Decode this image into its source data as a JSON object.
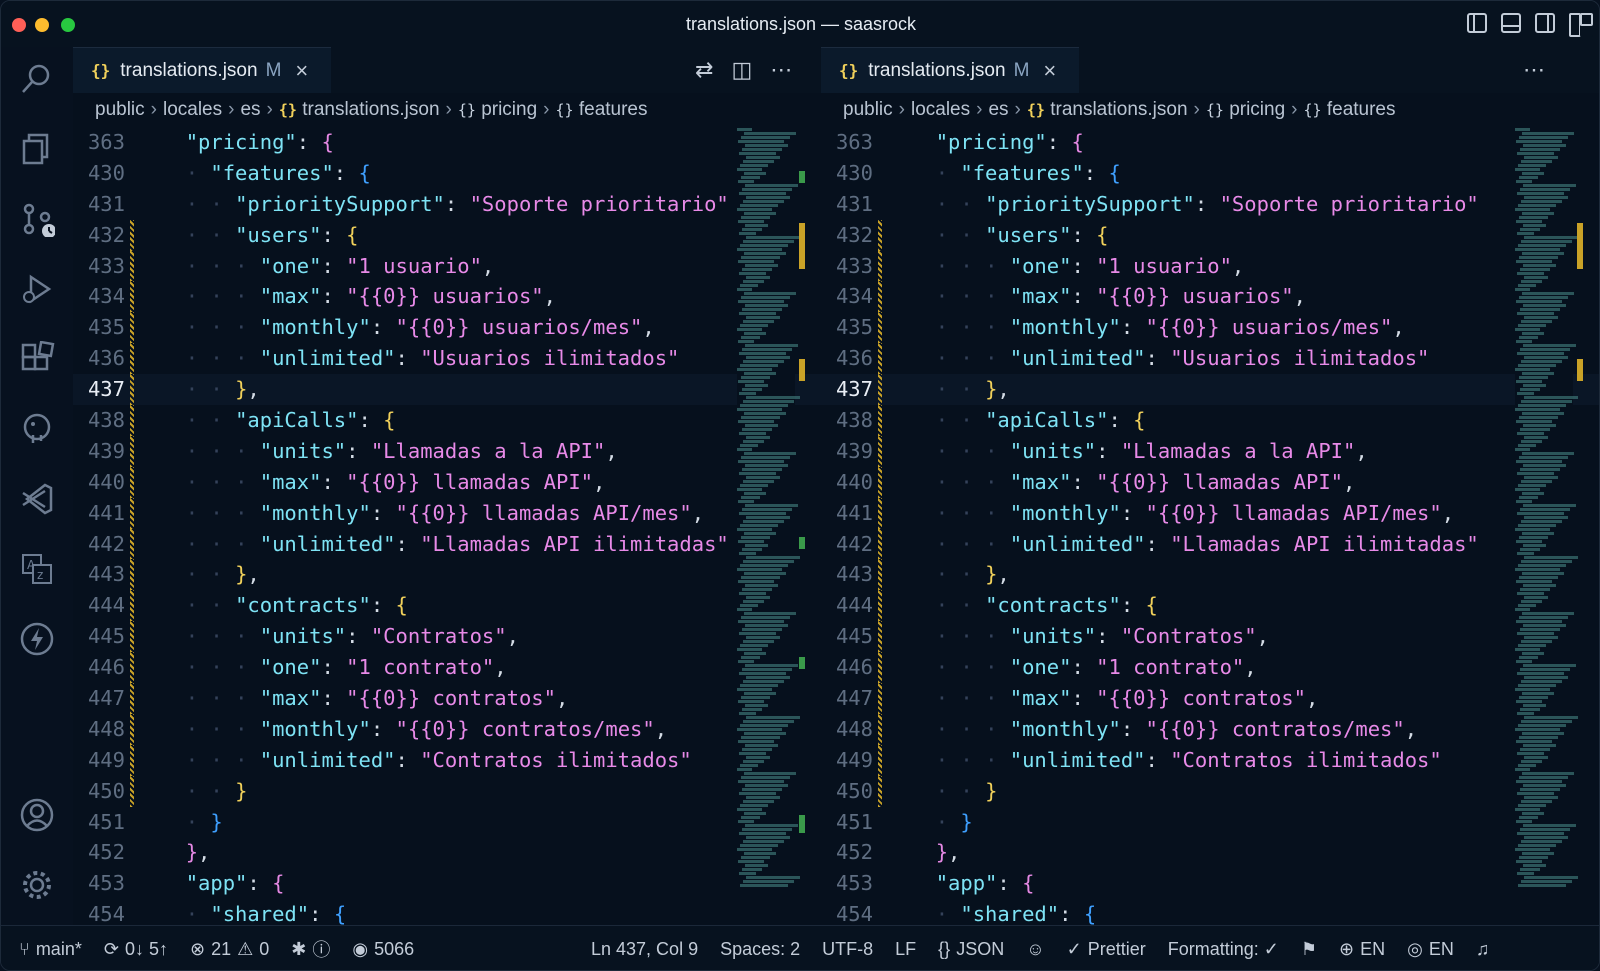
{
  "window": {
    "title": "translations.json — saasrock"
  },
  "left": {
    "tab": {
      "icon": "{}",
      "label": "translations.json",
      "status": "M"
    },
    "breadcrumb": [
      "public",
      "locales",
      "es",
      "translations.json",
      "pricing",
      "features"
    ]
  },
  "right": {
    "tab": {
      "icon": "{}",
      "label": "translations.json",
      "status": "M"
    },
    "breadcrumb": [
      "public",
      "locales",
      "es",
      "translations.json",
      "pricing",
      "features"
    ]
  },
  "lines": [
    {
      "n": "363",
      "t": "  \"pricing\": {"
    },
    {
      "n": "430",
      "t": "    \"features\": {"
    },
    {
      "n": "431",
      "t": "      \"prioritySupport\": \"Soporte prioritario\""
    },
    {
      "n": "432",
      "t": "      \"users\": {"
    },
    {
      "n": "433",
      "t": "        \"one\": \"1 usuario\","
    },
    {
      "n": "434",
      "t": "        \"max\": \"{{0}} usuarios\","
    },
    {
      "n": "435",
      "t": "        \"monthly\": \"{{0}} usuarios/mes\","
    },
    {
      "n": "436",
      "t": "        \"unlimited\": \"Usuarios ilimitados\""
    },
    {
      "n": "437",
      "t": "      },"
    },
    {
      "n": "438",
      "t": "      \"apiCalls\": {"
    },
    {
      "n": "439",
      "t": "        \"units\": \"Llamadas a la API\","
    },
    {
      "n": "440",
      "t": "        \"max\": \"{{0}} llamadas API\","
    },
    {
      "n": "441",
      "t": "        \"monthly\": \"{{0}} llamadas API/mes\","
    },
    {
      "n": "442",
      "t": "        \"unlimited\": \"Llamadas API ilimitadas\""
    },
    {
      "n": "443",
      "t": "      },"
    },
    {
      "n": "444",
      "t": "      \"contracts\": {"
    },
    {
      "n": "445",
      "t": "        \"units\": \"Contratos\","
    },
    {
      "n": "446",
      "t": "        \"one\": \"1 contrato\","
    },
    {
      "n": "447",
      "t": "        \"max\": \"{{0}} contratos\","
    },
    {
      "n": "448",
      "t": "        \"monthly\": \"{{0}} contratos/mes\","
    },
    {
      "n": "449",
      "t": "        \"unlimited\": \"Contratos ilimitados\""
    },
    {
      "n": "450",
      "t": "      }"
    },
    {
      "n": "451",
      "t": "    }"
    },
    {
      "n": "452",
      "t": "  },"
    },
    {
      "n": "453",
      "t": "  \"app\": {"
    },
    {
      "n": "454",
      "t": "    \"shared\": {"
    }
  ],
  "current_line": "437",
  "statusbar": {
    "branch": "main*",
    "sync": "0↓ 5↑",
    "errors": "21",
    "warnings": "0",
    "ports": "5066",
    "position": "Ln 437, Col 9",
    "spaces": "Spaces: 2",
    "encoding": "UTF-8",
    "eol": "LF",
    "language": "JSON",
    "formatter": "Prettier",
    "formatting": "Formatting: ✓",
    "lang1": "EN",
    "lang2": "EN"
  },
  "colors": {
    "key": "#7ee3f5",
    "string": "#e88ae8",
    "brace1": "#f1d15b",
    "brace2": "#e588e4",
    "brace3": "#3fa0ff"
  }
}
